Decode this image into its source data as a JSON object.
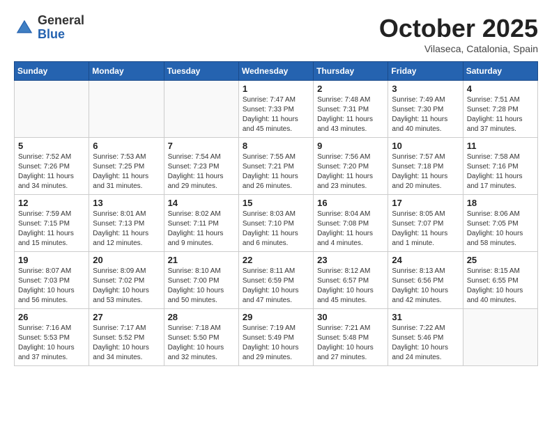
{
  "header": {
    "logo_general": "General",
    "logo_blue": "Blue",
    "month_title": "October 2025",
    "location": "Vilaseca, Catalonia, Spain"
  },
  "days_of_week": [
    "Sunday",
    "Monday",
    "Tuesday",
    "Wednesday",
    "Thursday",
    "Friday",
    "Saturday"
  ],
  "weeks": [
    {
      "days": [
        {
          "number": "",
          "empty": true
        },
        {
          "number": "",
          "empty": true
        },
        {
          "number": "",
          "empty": true
        },
        {
          "number": "1",
          "sunrise": "7:47 AM",
          "sunset": "7:33 PM",
          "daylight": "11 hours and 45 minutes."
        },
        {
          "number": "2",
          "sunrise": "7:48 AM",
          "sunset": "7:31 PM",
          "daylight": "11 hours and 43 minutes."
        },
        {
          "number": "3",
          "sunrise": "7:49 AM",
          "sunset": "7:30 PM",
          "daylight": "11 hours and 40 minutes."
        },
        {
          "number": "4",
          "sunrise": "7:51 AM",
          "sunset": "7:28 PM",
          "daylight": "11 hours and 37 minutes."
        }
      ]
    },
    {
      "days": [
        {
          "number": "5",
          "sunrise": "7:52 AM",
          "sunset": "7:26 PM",
          "daylight": "11 hours and 34 minutes."
        },
        {
          "number": "6",
          "sunrise": "7:53 AM",
          "sunset": "7:25 PM",
          "daylight": "11 hours and 31 minutes."
        },
        {
          "number": "7",
          "sunrise": "7:54 AM",
          "sunset": "7:23 PM",
          "daylight": "11 hours and 29 minutes."
        },
        {
          "number": "8",
          "sunrise": "7:55 AM",
          "sunset": "7:21 PM",
          "daylight": "11 hours and 26 minutes."
        },
        {
          "number": "9",
          "sunrise": "7:56 AM",
          "sunset": "7:20 PM",
          "daylight": "11 hours and 23 minutes."
        },
        {
          "number": "10",
          "sunrise": "7:57 AM",
          "sunset": "7:18 PM",
          "daylight": "11 hours and 20 minutes."
        },
        {
          "number": "11",
          "sunrise": "7:58 AM",
          "sunset": "7:16 PM",
          "daylight": "11 hours and 17 minutes."
        }
      ]
    },
    {
      "days": [
        {
          "number": "12",
          "sunrise": "7:59 AM",
          "sunset": "7:15 PM",
          "daylight": "11 hours and 15 minutes."
        },
        {
          "number": "13",
          "sunrise": "8:01 AM",
          "sunset": "7:13 PM",
          "daylight": "11 hours and 12 minutes."
        },
        {
          "number": "14",
          "sunrise": "8:02 AM",
          "sunset": "7:11 PM",
          "daylight": "11 hours and 9 minutes."
        },
        {
          "number": "15",
          "sunrise": "8:03 AM",
          "sunset": "7:10 PM",
          "daylight": "11 hours and 6 minutes."
        },
        {
          "number": "16",
          "sunrise": "8:04 AM",
          "sunset": "7:08 PM",
          "daylight": "11 hours and 4 minutes."
        },
        {
          "number": "17",
          "sunrise": "8:05 AM",
          "sunset": "7:07 PM",
          "daylight": "11 hours and 1 minute."
        },
        {
          "number": "18",
          "sunrise": "8:06 AM",
          "sunset": "7:05 PM",
          "daylight": "10 hours and 58 minutes."
        }
      ]
    },
    {
      "days": [
        {
          "number": "19",
          "sunrise": "8:07 AM",
          "sunset": "7:03 PM",
          "daylight": "10 hours and 56 minutes."
        },
        {
          "number": "20",
          "sunrise": "8:09 AM",
          "sunset": "7:02 PM",
          "daylight": "10 hours and 53 minutes."
        },
        {
          "number": "21",
          "sunrise": "8:10 AM",
          "sunset": "7:00 PM",
          "daylight": "10 hours and 50 minutes."
        },
        {
          "number": "22",
          "sunrise": "8:11 AM",
          "sunset": "6:59 PM",
          "daylight": "10 hours and 47 minutes."
        },
        {
          "number": "23",
          "sunrise": "8:12 AM",
          "sunset": "6:57 PM",
          "daylight": "10 hours and 45 minutes."
        },
        {
          "number": "24",
          "sunrise": "8:13 AM",
          "sunset": "6:56 PM",
          "daylight": "10 hours and 42 minutes."
        },
        {
          "number": "25",
          "sunrise": "8:15 AM",
          "sunset": "6:55 PM",
          "daylight": "10 hours and 40 minutes."
        }
      ]
    },
    {
      "days": [
        {
          "number": "26",
          "sunrise": "7:16 AM",
          "sunset": "5:53 PM",
          "daylight": "10 hours and 37 minutes."
        },
        {
          "number": "27",
          "sunrise": "7:17 AM",
          "sunset": "5:52 PM",
          "daylight": "10 hours and 34 minutes."
        },
        {
          "number": "28",
          "sunrise": "7:18 AM",
          "sunset": "5:50 PM",
          "daylight": "10 hours and 32 minutes."
        },
        {
          "number": "29",
          "sunrise": "7:19 AM",
          "sunset": "5:49 PM",
          "daylight": "10 hours and 29 minutes."
        },
        {
          "number": "30",
          "sunrise": "7:21 AM",
          "sunset": "5:48 PM",
          "daylight": "10 hours and 27 minutes."
        },
        {
          "number": "31",
          "sunrise": "7:22 AM",
          "sunset": "5:46 PM",
          "daylight": "10 hours and 24 minutes."
        },
        {
          "number": "",
          "empty": true
        }
      ]
    }
  ],
  "labels": {
    "sunrise": "Sunrise:",
    "sunset": "Sunset:",
    "daylight": "Daylight:"
  }
}
